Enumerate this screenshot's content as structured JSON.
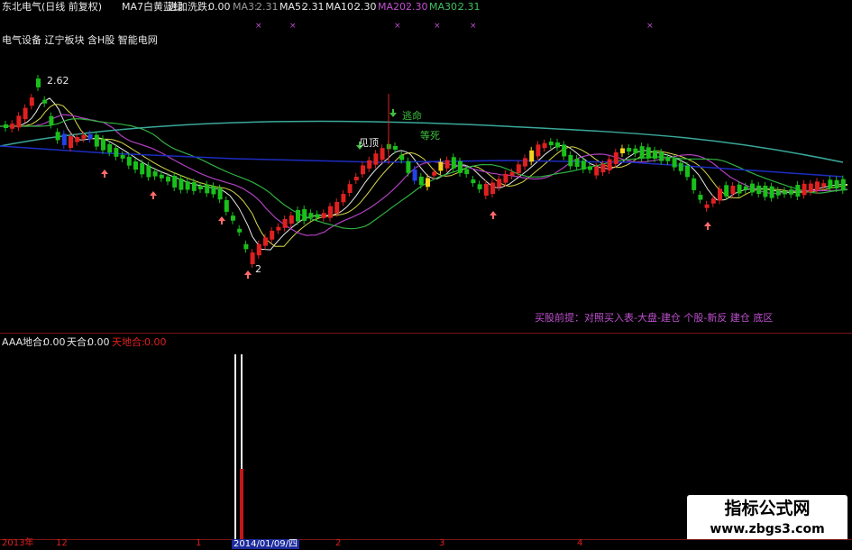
{
  "header": {
    "title": "东北电气(日线 前复权)",
    "ma_note": "MA7白黄蓝绿",
    "indicator_label": "进加洗跌:",
    "indicator_value": "0.00",
    "ma3_label": "MA3:",
    "ma3_value": "2.31",
    "ma5_label": "MA5:",
    "ma5_value": "2.31",
    "ma10_label": "MA10:",
    "ma10_value": "2.30",
    "ma20_label": "MA20:",
    "ma20_value": "2.30",
    "ma30_label": "MA30:",
    "ma30_value": "2.31"
  },
  "sectors": "电气设备 辽宁板块 含H股 智能电网",
  "annotations": {
    "high_price": "2.62",
    "low_price": "2",
    "jianding": "见顶",
    "taoming": "逃命",
    "dengsi": "等死",
    "buy_premise": "买股前提：对照买入表-大盘-建仓  个股-新反 建仓 底区"
  },
  "lower_panel": {
    "name": "AAA",
    "di_label": "地合:",
    "di_value": "0.00",
    "tian_label": "天合:",
    "tian_value": "0.00",
    "tiandi_label": "天地合:",
    "tiandi_value": "0.00"
  },
  "time_axis": {
    "labels": [
      "2013年",
      "12",
      "1",
      "2",
      "3",
      "4"
    ],
    "selected_date": "2014/01/09/四"
  },
  "watermark": {
    "title": "指标公式网",
    "url": "www.zbgs3.com"
  },
  "colors": {
    "up": "#e02020",
    "down": "#19c01a",
    "yellow": "#f5d21c",
    "blue": "#2342e6",
    "ma_white": "#e8e8e8",
    "ma_yellow": "#d8d84a",
    "ma_purple": "#b040c0",
    "ma_green": "#30b040",
    "ma_teal": "#3aa89a"
  }
}
